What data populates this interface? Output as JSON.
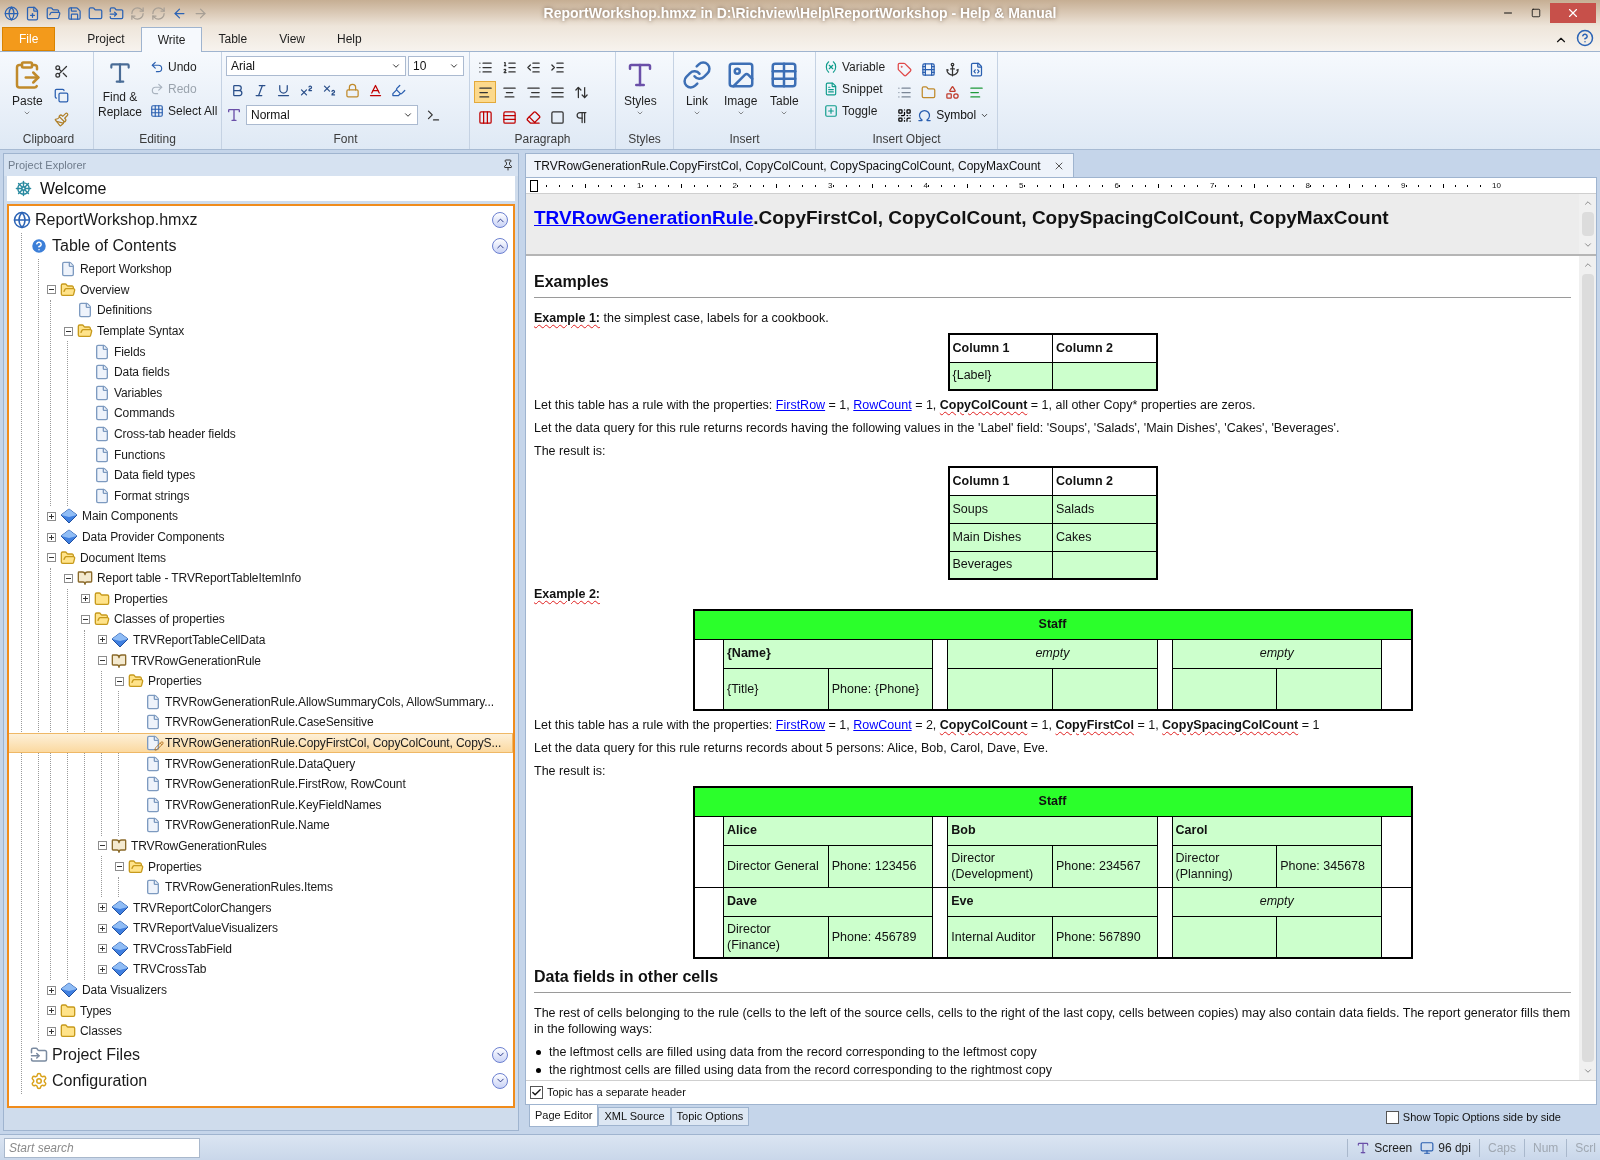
{
  "window": {
    "title": "ReportWorkshop.hmxz in D:\\Richview\\Help\\ReportWorkshop - Help & Manual"
  },
  "ribbon_tabs": [
    {
      "label": "File",
      "kind": "file",
      "selected": false
    },
    {
      "label": "Project",
      "kind": "tab",
      "selected": false
    },
    {
      "label": "Write",
      "kind": "tab",
      "selected": true
    },
    {
      "label": "Table",
      "kind": "tab",
      "selected": false
    },
    {
      "label": "View",
      "kind": "tab",
      "selected": false
    },
    {
      "label": "Help",
      "kind": "tab",
      "selected": false
    }
  ],
  "ribbon": {
    "clipboard": {
      "label": "Clipboard",
      "paste": "Paste"
    },
    "editing": {
      "label": "Editing",
      "find": "Find & Replace",
      "undo": {
        "label": "Undo",
        "disabled": false
      },
      "redo": {
        "label": "Redo",
        "disabled": true
      },
      "select_all": "Select All"
    },
    "font": {
      "label": "Font",
      "font_name": "Arial",
      "font_size": "10",
      "style": "Normal"
    },
    "paragraph": {
      "label": "Paragraph",
      "align": [
        {
          "selected": true
        },
        {
          "selected": false
        },
        {
          "selected": false
        },
        {
          "selected": false
        }
      ]
    },
    "styles": {
      "label": "Styles",
      "button": "Styles"
    },
    "insert": {
      "label": "Insert",
      "buttons": [
        "Link",
        "Image",
        "Table"
      ]
    },
    "insert_object": {
      "label": "Insert Object",
      "buttons": [
        "Variable",
        "Snippet",
        "Toggle"
      ],
      "symbol": "Symbol"
    }
  },
  "explorer": {
    "title": "Project Explorer",
    "welcome": "Welcome",
    "tree": [
      {
        "label": "ReportWorkshop.hmxz",
        "kind": "project",
        "expanded": true,
        "selected": false,
        "children": [
          {
            "label": "Table of Contents",
            "kind": "toc",
            "expanded": true,
            "selected": false,
            "children": [
              {
                "label": "Report Workshop",
                "kind": "page",
                "selected": false
              },
              {
                "label": "Overview",
                "kind": "folder",
                "expanded": true,
                "selected": false,
                "children": [
                  {
                    "label": "Definitions",
                    "kind": "page",
                    "selected": false
                  },
                  {
                    "label": "Template Syntax",
                    "kind": "folder",
                    "expanded": true,
                    "selected": false,
                    "children": [
                      {
                        "label": "Fields",
                        "kind": "page",
                        "selected": false
                      },
                      {
                        "label": "Data fields",
                        "kind": "page",
                        "selected": false
                      },
                      {
                        "label": "Variables",
                        "kind": "page",
                        "selected": false
                      },
                      {
                        "label": "Commands",
                        "kind": "page",
                        "selected": false
                      },
                      {
                        "label": "Cross-tab header fields",
                        "kind": "page",
                        "selected": false
                      },
                      {
                        "label": "Functions",
                        "kind": "page",
                        "selected": false
                      },
                      {
                        "label": "Data field types",
                        "kind": "page",
                        "selected": false
                      },
                      {
                        "label": "Format strings",
                        "kind": "page",
                        "selected": false
                      }
                    ]
                  }
                ]
              },
              {
                "label": "Main Components",
                "kind": "component",
                "expanded": false,
                "selected": false
              },
              {
                "label": "Data Provider Components",
                "kind": "component",
                "expanded": false,
                "selected": false
              },
              {
                "label": "Document Items",
                "kind": "folder",
                "expanded": true,
                "selected": false,
                "children": [
                  {
                    "label": "Report table - TRVReportTableItemInfo",
                    "kind": "book",
                    "expanded": true,
                    "selected": false,
                    "children": [
                      {
                        "label": "Properties",
                        "kind": "folder",
                        "expanded": false,
                        "selected": false
                      },
                      {
                        "label": "Classes of properties",
                        "kind": "folder",
                        "expanded": true,
                        "selected": false,
                        "children": [
                          {
                            "label": "TRVReportTableCellData",
                            "kind": "component",
                            "expanded": false,
                            "selected": false
                          },
                          {
                            "label": "TRVRowGenerationRule",
                            "kind": "book",
                            "expanded": true,
                            "selected": false,
                            "children": [
                              {
                                "label": "Properties",
                                "kind": "folder",
                                "expanded": true,
                                "selected": false,
                                "children": [
                                  {
                                    "label": "TRVRowGenerationRule.AllowSummaryCols, AllowSummary...",
                                    "kind": "page",
                                    "selected": false
                                  },
                                  {
                                    "label": "TRVRowGenerationRule.CaseSensitive",
                                    "kind": "page",
                                    "selected": false
                                  },
                                  {
                                    "label": "TRVRowGenerationRule.CopyFirstCol, CopyColCount, CopyS...",
                                    "kind": "page",
                                    "selected": true
                                  },
                                  {
                                    "label": "TRVRowGenerationRule.DataQuery",
                                    "kind": "page",
                                    "selected": false
                                  },
                                  {
                                    "label": "TRVRowGenerationRule.FirstRow, RowCount",
                                    "kind": "page",
                                    "selected": false
                                  },
                                  {
                                    "label": "TRVRowGenerationRule.KeyFieldNames",
                                    "kind": "page",
                                    "selected": false
                                  },
                                  {
                                    "label": "TRVRowGenerationRule.Name",
                                    "kind": "page",
                                    "selected": false
                                  }
                                ]
                              }
                            ]
                          },
                          {
                            "label": "TRVRowGenerationRules",
                            "kind": "book",
                            "expanded": true,
                            "selected": false,
                            "children": [
                              {
                                "label": "Properties",
                                "kind": "folder",
                                "expanded": true,
                                "selected": false,
                                "children": [
                                  {
                                    "label": "TRVRowGenerationRules.Items",
                                    "kind": "page",
                                    "selected": false
                                  }
                                ]
                              }
                            ]
                          },
                          {
                            "label": "TRVReportColorChangers",
                            "kind": "component",
                            "expanded": false,
                            "selected": false
                          },
                          {
                            "label": "TRVReportValueVisualizers",
                            "kind": "component",
                            "expanded": false,
                            "selected": false
                          },
                          {
                            "label": "TRVCrossTabField",
                            "kind": "component",
                            "expanded": false,
                            "selected": false
                          },
                          {
                            "label": "TRVCrossTab",
                            "kind": "component",
                            "expanded": false,
                            "selected": false
                          }
                        ]
                      }
                    ]
                  }
                ]
              },
              {
                "label": "Data Visualizers",
                "kind": "component",
                "expanded": false,
                "selected": false
              },
              {
                "label": "Types",
                "kind": "folder",
                "expanded": false,
                "selected": false
              },
              {
                "label": "Classes",
                "kind": "folder",
                "expanded": false,
                "selected": false
              }
            ]
          },
          {
            "label": "Project Files",
            "kind": "files",
            "expanded": false,
            "selected": false
          },
          {
            "label": "Configuration",
            "kind": "config",
            "expanded": false,
            "selected": false
          }
        ]
      }
    ]
  },
  "editor": {
    "tab": {
      "label": "TRVRowGenerationRule.CopyFirstCol, CopyColCount, CopySpacingColCount, CopyMaxCount",
      "selected": true
    },
    "ruler": [
      "1",
      "2",
      "3",
      "4",
      "5",
      "6",
      "7",
      "8",
      "9",
      "10"
    ],
    "topic_title": [
      {
        "kind": "link",
        "text": "TRVRowGenerationRule"
      },
      {
        "kind": "text",
        "text": ".CopyFirstCol, CopyColCount, CopySpacingColCount, CopyMaxCount"
      }
    ],
    "blocks": [
      {
        "kind": "heading",
        "text": "Examples"
      },
      {
        "kind": "para",
        "parts": [
          {
            "kind": "bold",
            "text": "Example 1:"
          },
          {
            "kind": "text",
            "text": " the simplest case, labels for a cookbook."
          }
        ]
      },
      {
        "kind": "grid",
        "header": [
          "Column 1",
          "Column 2"
        ],
        "rows": [
          [
            "{Label}"
          ]
        ]
      },
      {
        "kind": "para",
        "parts": [
          {
            "kind": "text",
            "text": "Let this table has a rule with the properties: "
          },
          {
            "kind": "link",
            "text": "FirstRow"
          },
          {
            "kind": "text",
            "text": " = 1, "
          },
          {
            "kind": "link",
            "text": "RowCount"
          },
          {
            "kind": "text",
            "text": " = 1, "
          },
          {
            "kind": "bold",
            "text": "CopyColCount"
          },
          {
            "kind": "text",
            "text": " = 1, all other Copy* properties are zeros."
          }
        ]
      },
      {
        "kind": "para",
        "parts": [
          {
            "kind": "text",
            "text": "Let the data query for this rule returns records having the following values in the 'Label' field: 'Soups', 'Salads', 'Main Dishes', 'Cakes', 'Beverages'."
          }
        ]
      },
      {
        "kind": "para",
        "parts": [
          {
            "kind": "text",
            "text": "The result is:"
          }
        ]
      },
      {
        "kind": "grid",
        "header": [
          "Column 1",
          "Column 2"
        ],
        "rows": [
          [
            "Soups",
            "Salads"
          ],
          [
            "Main Dishes",
            "Cakes"
          ],
          [
            "Beverages"
          ]
        ]
      },
      {
        "kind": "para",
        "parts": [
          {
            "kind": "bold",
            "text": "Example 2:"
          }
        ]
      },
      {
        "kind": "staff",
        "header": "Staff",
        "rows": [
          [
            {
              "kind": "record",
              "name": "{Name}",
              "title": "{Title}",
              "phone": "Phone: {Phone}"
            },
            {
              "kind": "empty",
              "label": "empty"
            },
            {
              "kind": "empty",
              "label": "empty"
            }
          ]
        ]
      },
      {
        "kind": "para",
        "parts": [
          {
            "kind": "text",
            "text": "Let this table has a rule with the properties: "
          },
          {
            "kind": "link",
            "text": "FirstRow"
          },
          {
            "kind": "text",
            "text": " = 1, "
          },
          {
            "kind": "link",
            "text": "RowCount"
          },
          {
            "kind": "text",
            "text": " = 2, "
          },
          {
            "kind": "bold",
            "text": "CopyColCount"
          },
          {
            "kind": "text",
            "text": " = 1, "
          },
          {
            "kind": "bold",
            "text": "CopyFirstCol"
          },
          {
            "kind": "text",
            "text": " = 1, "
          },
          {
            "kind": "bold",
            "text": "CopySpacingColCount"
          },
          {
            "kind": "text",
            "text": " = 1"
          }
        ]
      },
      {
        "kind": "para",
        "parts": [
          {
            "kind": "text",
            "text": "Let the data query for this rule returns records about 5 persons: Alice, Bob, Carol, Dave, Eve."
          }
        ]
      },
      {
        "kind": "para",
        "parts": [
          {
            "kind": "text",
            "text": "The result is:"
          }
        ]
      },
      {
        "kind": "staff",
        "header": "Staff",
        "rows": [
          [
            {
              "kind": "record",
              "name": "Alice",
              "title": "Director General",
              "phone": "Phone: 123456"
            },
            {
              "kind": "record",
              "name": "Bob",
              "title": "Director (Development)",
              "phone": "Phone: 234567"
            },
            {
              "kind": "record",
              "name": "Carol",
              "title": "Director (Planning)",
              "phone": "Phone: 345678"
            }
          ],
          [
            {
              "kind": "record",
              "name": "Dave",
              "title": "Director (Finance)",
              "phone": "Phone: 456789"
            },
            {
              "kind": "record",
              "name": "Eve",
              "title": "Internal Auditor",
              "phone": "Phone: 567890"
            },
            {
              "kind": "empty",
              "label": "empty"
            }
          ]
        ]
      },
      {
        "kind": "heading",
        "text": "Data fields in other cells"
      },
      {
        "kind": "para",
        "parts": [
          {
            "kind": "text",
            "text": "The rest of cells belonging to the rule (cells to the left of the source cells, cells to the right of the last copy, cells between copies) may also contain data fields. The report generator fills them in the following ways:"
          }
        ]
      },
      {
        "kind": "bullets",
        "items": [
          "the leftmost cells are filled using data from the record corresponding to the leftmost copy",
          "the rightmost cells are filled using data from the record corresponding to the rightmost copy"
        ]
      }
    ],
    "header_checkbox": {
      "label": "Topic has a separate header",
      "checked": true
    },
    "view_tabs": [
      {
        "label": "Page Editor",
        "selected": true
      },
      {
        "label": "XML Source",
        "selected": false
      },
      {
        "label": "Topic Options",
        "selected": false
      }
    ],
    "side_by_side": {
      "label": "Show Topic Options side by side",
      "checked": false
    }
  },
  "status_bar": {
    "search": {
      "placeholder": "Start search"
    },
    "zoom_mode": "Screen",
    "dpi": "96 dpi",
    "indicators": [
      {
        "label": "Caps",
        "on": false
      },
      {
        "label": "Num",
        "on": false
      },
      {
        "label": "Scrl",
        "on": false
      }
    ]
  }
}
